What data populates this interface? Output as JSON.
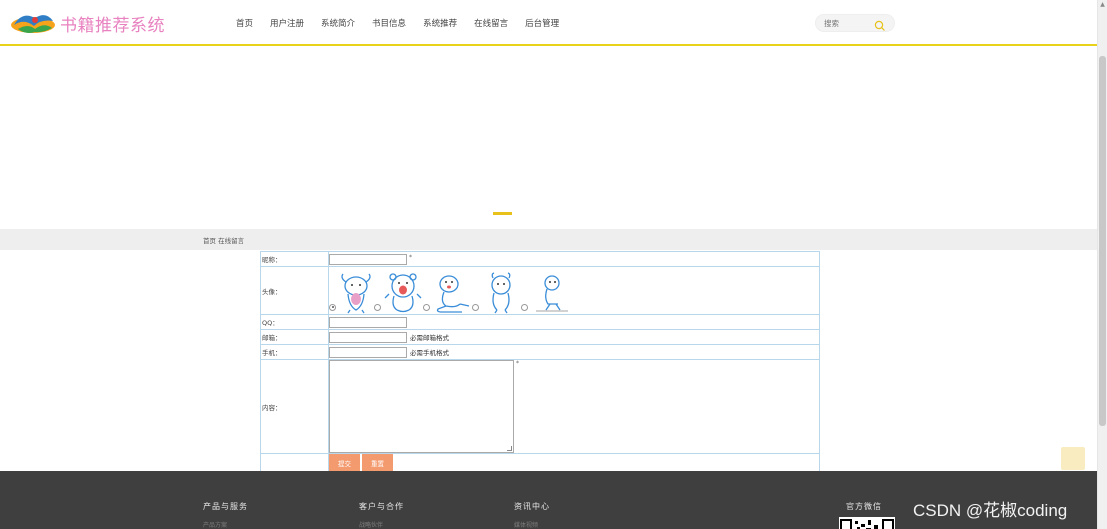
{
  "header": {
    "logo_text": "书籍推荐系统",
    "nav": [
      "首页",
      "用户注册",
      "系统简介",
      "书目信息",
      "系统推荐",
      "在线留言",
      "后台管理"
    ],
    "search_placeholder": "搜索"
  },
  "breadcrumb": "首页 在线留言",
  "form": {
    "nickname_label": "昵称：",
    "nickname_required": "*",
    "avatar_label": "头像：",
    "avatar_options": [
      "avatar-1",
      "avatar-2",
      "avatar-3",
      "avatar-4",
      "avatar-5"
    ],
    "avatar_selected": 0,
    "qq_label": "QQ：",
    "email_label": "邮箱：",
    "email_hint": "必需邮箱格式",
    "phone_label": "手机：",
    "phone_hint": "必需手机格式",
    "content_label": "内容：",
    "content_required": "*",
    "submit_label": "提交",
    "reset_label": "重置"
  },
  "footer": {
    "columns": [
      {
        "title": "产品与服务",
        "sub": "产品方案"
      },
      {
        "title": "客户与合作",
        "sub": "战略伙伴"
      },
      {
        "title": "资讯中心",
        "sub": "媒体视频"
      }
    ],
    "wechat_title": "官方微信"
  },
  "watermark": "CSDN @花椒coding",
  "colors": {
    "accent_yellow": "#e8d21a",
    "logo_pink": "#e882c0",
    "button_orange": "#f39a6f",
    "table_border": "#b8d7ea",
    "footer_bg": "#3f3f3f"
  }
}
